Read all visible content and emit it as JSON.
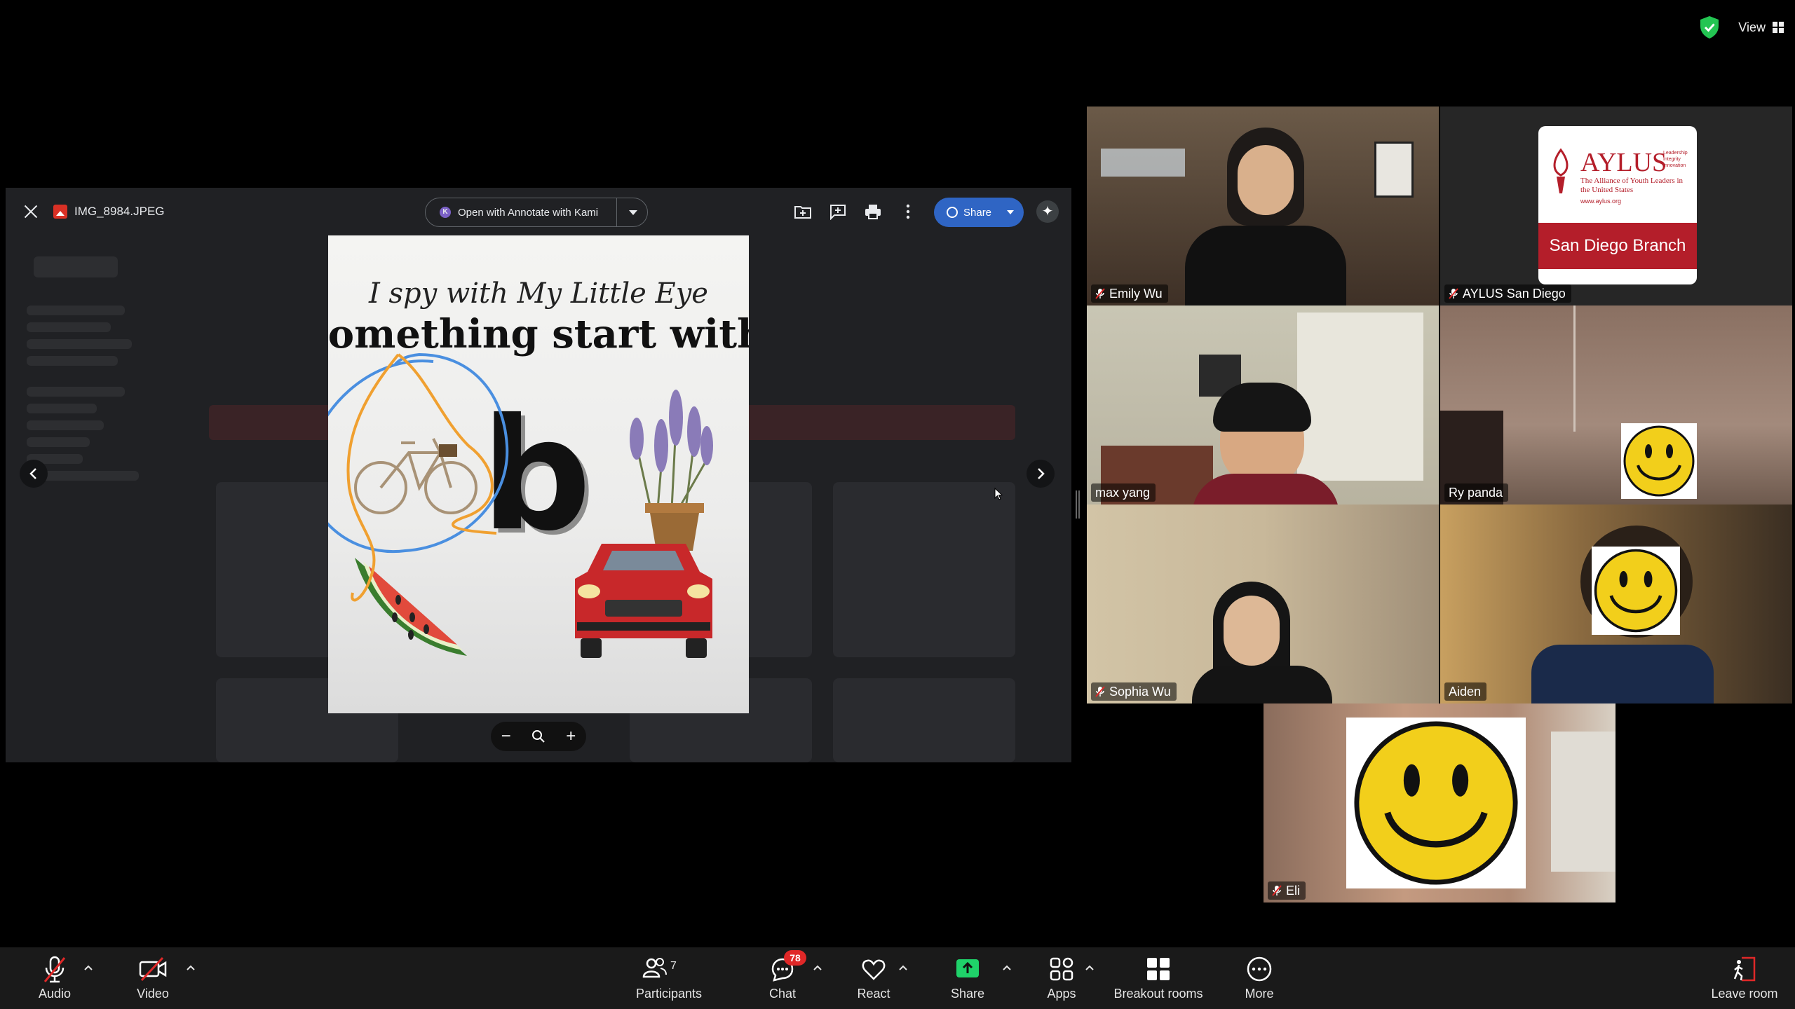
{
  "window": {
    "view_label": "View"
  },
  "viewer": {
    "file_name": "IMG_8984.JPEG",
    "open_with_label": "Open with Annotate with Kami",
    "share_label": "Share"
  },
  "photo": {
    "line1": "I spy with My Little Eye",
    "line2": "something start with",
    "letter": "b"
  },
  "gallery": {
    "tiles": [
      {
        "name": "Emily Wu",
        "muted": true
      },
      {
        "name": "AYLUS San Diego",
        "muted": true,
        "logo_title": "AYLUS",
        "logo_sub": "The Alliance of Youth Leaders in the United States",
        "logo_url": "www.aylus.org",
        "logo_side": "Leadership Integrity Innovation",
        "branch": "San Diego Branch"
      },
      {
        "name": "max yang",
        "muted": false,
        "active": true
      },
      {
        "name": "Ry panda",
        "muted": false
      },
      {
        "name": "Sophia Wu",
        "muted": true
      },
      {
        "name": "Aiden",
        "muted": false
      },
      {
        "name": "Eli",
        "muted": true
      }
    ]
  },
  "toolbar": {
    "audio": "Audio",
    "video": "Video",
    "participants": "Participants",
    "participants_count": "7",
    "chat": "Chat",
    "chat_badge": "78",
    "react": "React",
    "share": "Share",
    "apps": "Apps",
    "breakout": "Breakout rooms",
    "more": "More",
    "leave": "Leave room"
  },
  "colors": {
    "active_speaker": "#2ee06a",
    "share_green": "#1fd26a",
    "badge_red": "#e02828",
    "drive_share_blue": "#2f65c4"
  }
}
